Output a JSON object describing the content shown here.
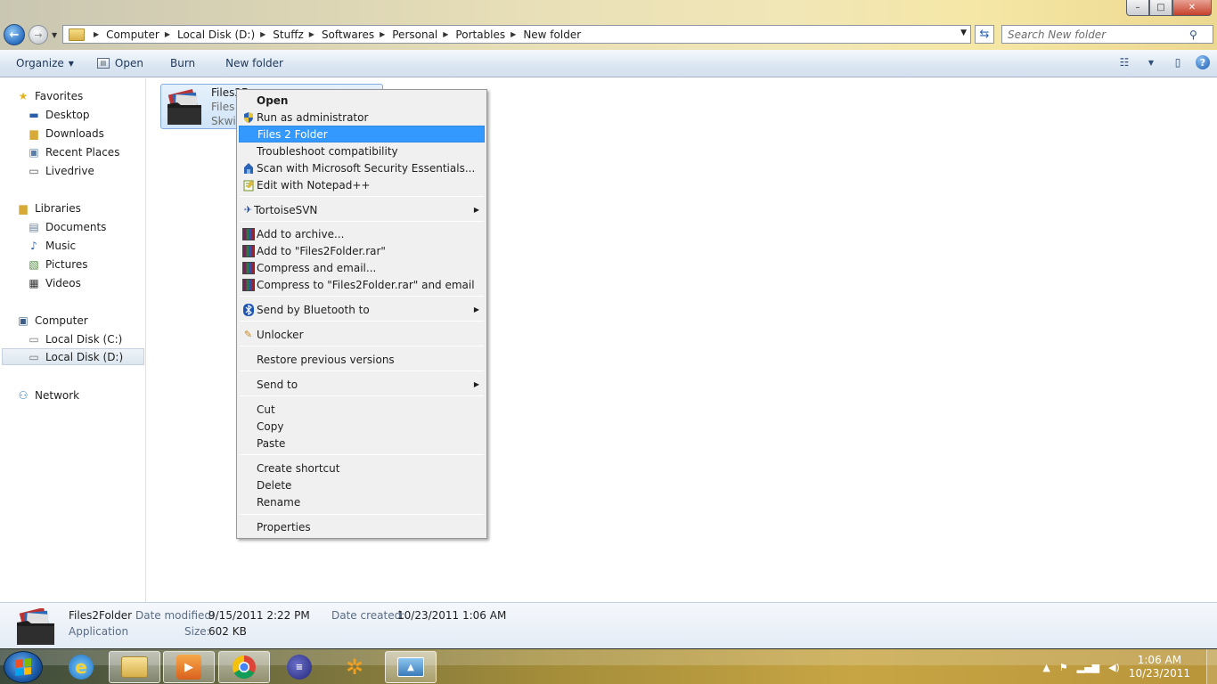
{
  "window": {
    "controls": {
      "minimize": "–",
      "maximize": "□",
      "close": "✕"
    }
  },
  "address": {
    "crumbs": [
      "Computer",
      "Local Disk (D:)",
      "Stuffz",
      "Softwares",
      "Personal",
      "Portables",
      "New folder"
    ]
  },
  "search": {
    "placeholder": "Search New folder"
  },
  "toolbar": {
    "organize_label": "Organize",
    "open_label": "Open",
    "burn_label": "Burn",
    "new_folder_label": "New folder"
  },
  "nav": {
    "favorites": "Favorites",
    "desktop": "Desktop",
    "downloads": "Downloads",
    "recent_places": "Recent Places",
    "livedrive": "Livedrive",
    "libraries": "Libraries",
    "documents": "Documents",
    "music": "Music",
    "pictures": "Pictures",
    "videos": "Videos",
    "computer": "Computer",
    "local_c": "Local Disk (C:)",
    "local_d": "Local Disk (D:)",
    "network": "Network"
  },
  "file": {
    "name": "Files2Folder",
    "tile_name": "Files2F",
    "tile_desc": "Files 2",
    "tile_company": "Skwir"
  },
  "menu": {
    "open": "Open",
    "run_admin": "Run as administrator",
    "files2folder": "Files 2 Folder",
    "troubleshoot": "Troubleshoot compatibility",
    "scan": "Scan with Microsoft Security Essentials...",
    "notepad": "Edit with Notepad++",
    "tortoise": "TortoiseSVN",
    "add_archive": "Add to archive...",
    "add_rar": "Add to \"Files2Folder.rar\"",
    "compress_email": "Compress and email...",
    "compress_rar_email": "Compress to \"Files2Folder.rar\" and email",
    "bluetooth": "Send by Bluetooth to",
    "unlocker": "Unlocker",
    "restore": "Restore previous versions",
    "send_to": "Send to",
    "cut": "Cut",
    "copy": "Copy",
    "paste": "Paste",
    "create_shortcut": "Create shortcut",
    "delete": "Delete",
    "rename": "Rename",
    "properties": "Properties"
  },
  "details": {
    "name": "Files2Folder",
    "type": "Application",
    "date_modified_label": "Date modified:",
    "date_modified": "9/15/2011 2:22 PM",
    "size_label": "Size:",
    "size": "602 KB",
    "date_created_label": "Date created:",
    "date_created": "10/23/2011 1:06 AM"
  },
  "taskbar": {
    "time": "1:06 AM",
    "date": "10/23/2011"
  },
  "colors": {
    "menu_highlight": "#3399ff",
    "selection_bg": "#cfe4f8",
    "command_bar": "#dbe6f2"
  }
}
